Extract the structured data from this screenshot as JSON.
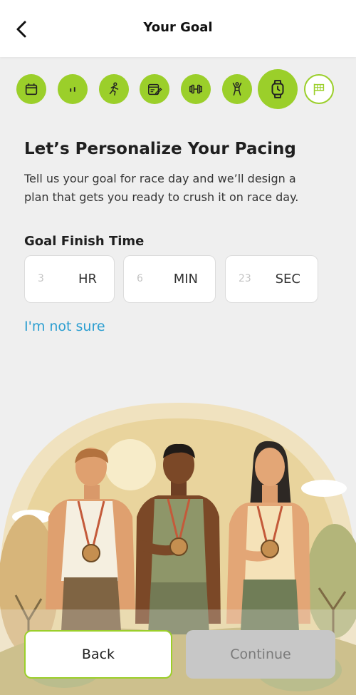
{
  "header": {
    "title": "Your Goal",
    "back_icon": "chevron-left-icon"
  },
  "steps": [
    {
      "icon": "calendar-icon",
      "state": "complete"
    },
    {
      "icon": "bars-icon",
      "state": "complete"
    },
    {
      "icon": "runner-icon",
      "state": "complete"
    },
    {
      "icon": "schedule-edit-icon",
      "state": "complete"
    },
    {
      "icon": "dumbbell-icon",
      "state": "complete"
    },
    {
      "icon": "stretch-person-icon",
      "state": "complete"
    },
    {
      "icon": "watch-icon",
      "state": "active"
    },
    {
      "icon": "flag-icon",
      "state": "pending"
    }
  ],
  "main": {
    "heading": "Let’s Personalize Your Pacing",
    "description": "Tell us your goal for race day and we’ll design a plan that gets you ready to crush it on race day.",
    "goal_label": "Goal Finish Time",
    "time_fields": [
      {
        "placeholder": "3",
        "unit": "HR"
      },
      {
        "placeholder": "6",
        "unit": "MIN"
      },
      {
        "placeholder": "23",
        "unit": "SEC"
      }
    ],
    "not_sure_link": "I'm not sure"
  },
  "footer": {
    "back_label": "Back",
    "continue_label": "Continue"
  },
  "colors": {
    "accent": "#9bcf2a",
    "link": "#2b9ed1",
    "disabled": "#c7c7c7"
  }
}
